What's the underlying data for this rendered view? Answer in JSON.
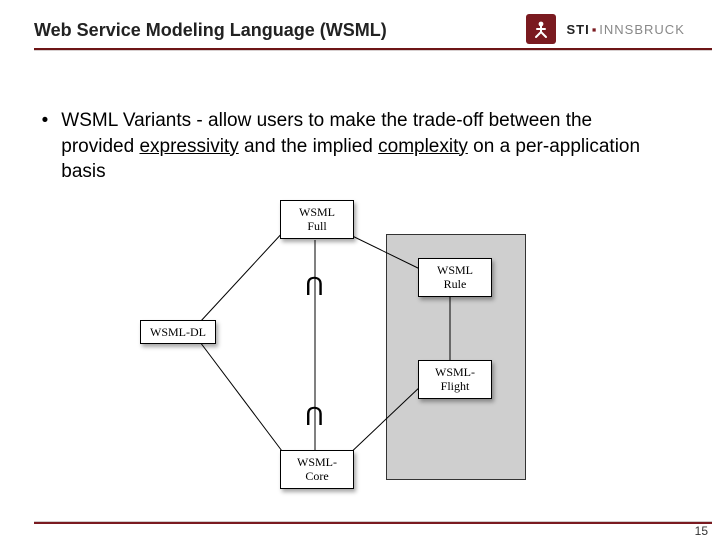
{
  "header": {
    "title": "Web Service Modeling Language (WSML)"
  },
  "logo": {
    "brand": "STI",
    "separator": "▪",
    "location": "INNSBRUCK",
    "icon_name": "sti-logo-icon"
  },
  "body": {
    "bullet_marker": "•",
    "text_before": "WSML Variants - allow users to make the trade-off between the provided ",
    "expressivity": "expressivity",
    "text_middle": " and the implied ",
    "complexity": "complexity",
    "text_after": " on a per-application basis"
  },
  "diagram": {
    "boxes": {
      "full": {
        "line1": "WSML",
        "line2": "Full"
      },
      "dl": {
        "line1": "WSML-DL",
        "line2": ""
      },
      "rule": {
        "line1": "WSML",
        "line2": "Rule"
      },
      "flight": {
        "line1": "WSML-",
        "line2": "Flight"
      },
      "core": {
        "line1": "WSML-",
        "line2": "Core"
      }
    },
    "union_symbol": "U"
  },
  "footer": {
    "page_number": "15"
  }
}
